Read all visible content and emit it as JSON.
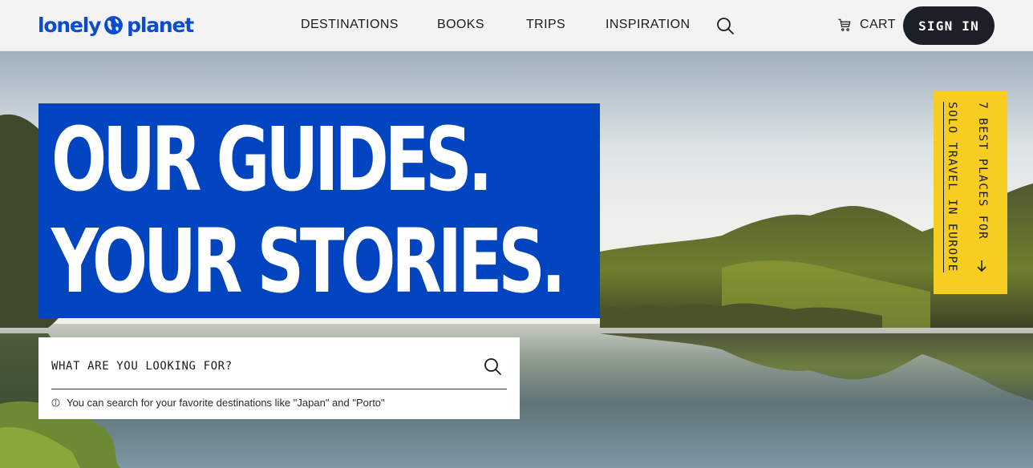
{
  "header": {
    "logo_left": "lonely",
    "logo_right": "planet",
    "nav": [
      "DESTINATIONS",
      "BOOKS",
      "TRIPS",
      "INSPIRATION"
    ],
    "cart_label": "CART",
    "signin_label": "SIGN IN"
  },
  "hero": {
    "headline_line1": "OUR GUIDES.",
    "headline_line2": "YOUR STORIES.",
    "search": {
      "placeholder": "WHAT ARE YOU LOOKING FOR?",
      "value": "",
      "hint": "You can search for your favorite destinations like \"Japan\" and \"Porto\""
    },
    "promo": {
      "line1": "7 BEST PLACES FOR",
      "line2": "SOLO TRAVEL IN EUROPE"
    }
  },
  "colors": {
    "brand_blue": "#0045bf",
    "promo_yellow": "#f7cd22",
    "signin_bg": "#1c1f26",
    "header_bg": "#f3f3f3"
  },
  "icons": {
    "logo": "globe-icon",
    "search": "search-icon",
    "cart": "cart-icon",
    "info": "info-icon",
    "arrow": "arrow-down-icon"
  }
}
